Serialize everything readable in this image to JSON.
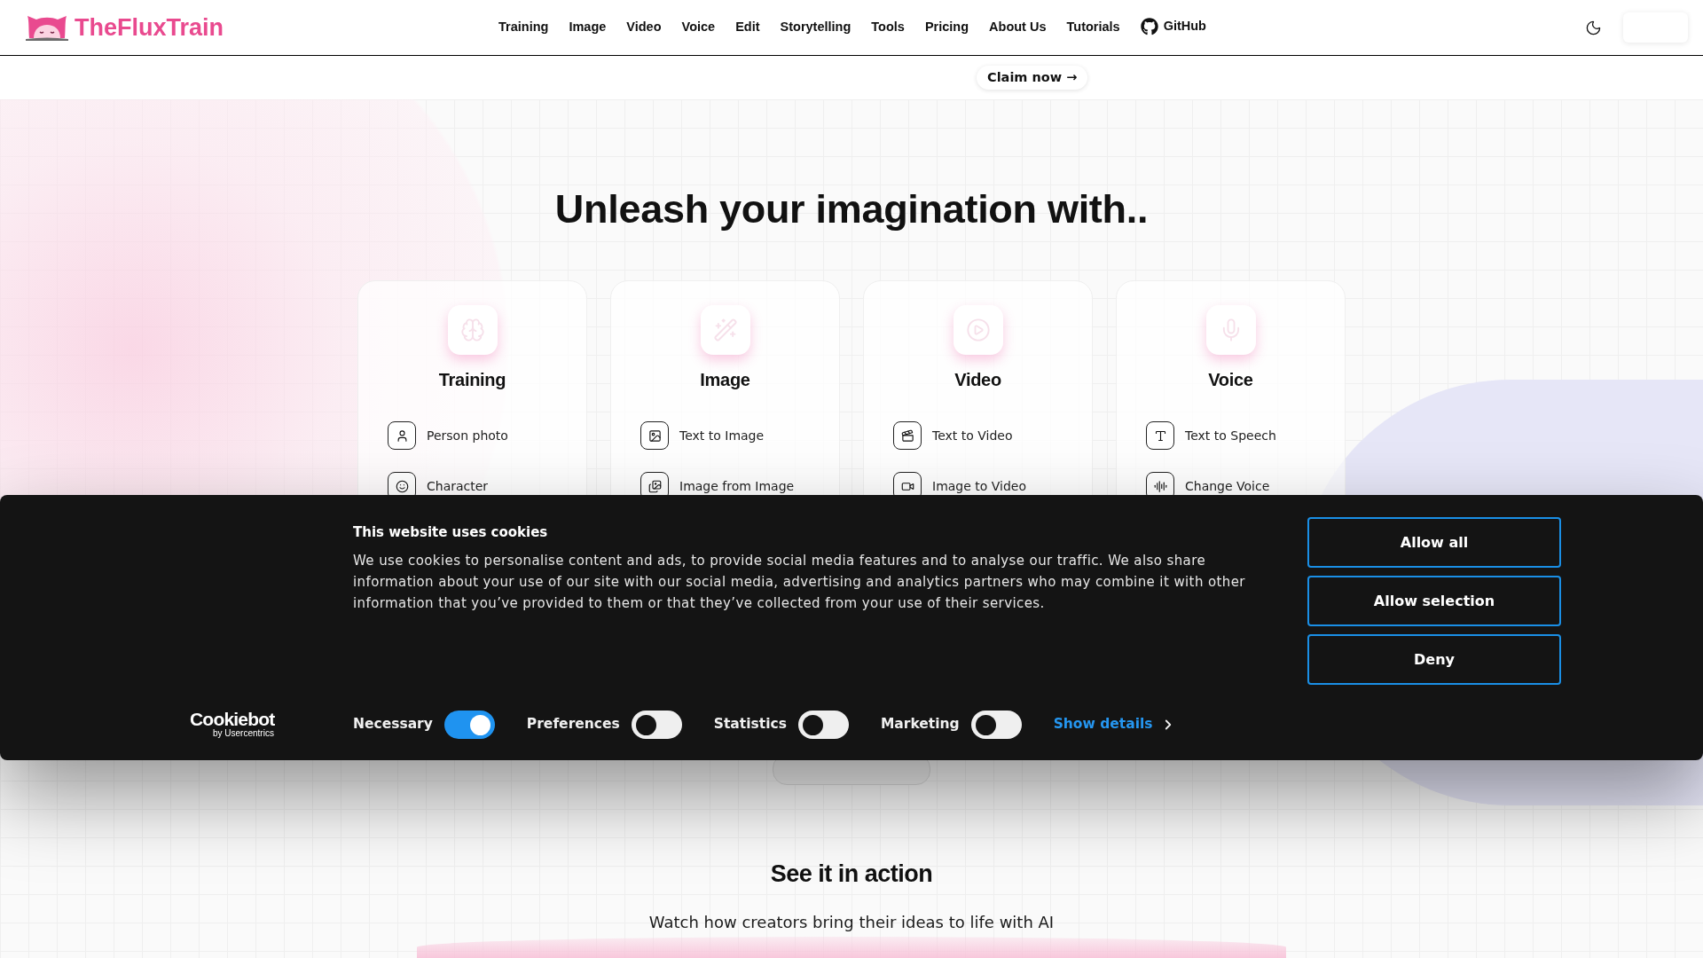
{
  "header": {
    "logo_text": "TheFluxTrain",
    "nav": [
      {
        "label": "Training",
        "kind": "link"
      },
      {
        "label": "Image",
        "kind": "link"
      },
      {
        "label": "Video",
        "kind": "link"
      },
      {
        "label": "Voice",
        "kind": "link"
      },
      {
        "label": "Edit",
        "kind": "link"
      },
      {
        "label": "Storytelling",
        "kind": "link"
      },
      {
        "label": "Tools",
        "kind": "link"
      },
      {
        "label": "Pricing",
        "kind": "link"
      },
      {
        "label": "About Us",
        "kind": "link"
      },
      {
        "label": "Tutorials",
        "kind": "link"
      },
      {
        "label": "GitHub",
        "kind": "github"
      }
    ]
  },
  "promo_bar": {
    "button": "Claim now →"
  },
  "hero": {
    "title": "Unleash your imagination with..",
    "cards": [
      {
        "title": "Training",
        "items": [
          "Person photo",
          "Character"
        ]
      },
      {
        "title": "Image",
        "items": [
          "Text to Image",
          "Image from Image"
        ]
      },
      {
        "title": "Video",
        "items": [
          "Text to Video",
          "Image to Video"
        ]
      },
      {
        "title": "Voice",
        "items": [
          "Text to Speech",
          "Change Voice"
        ]
      }
    ]
  },
  "showcase": {
    "title": "See it in action",
    "subtitle": "Watch how creators bring their ideas to life with AI"
  },
  "cookie_banner": {
    "title": "This website uses cookies",
    "text": "We use cookies to personalise content and ads, to provide social media features and to analyse our traffic. We also share information about your use of our site with our social media, advertising and analytics partners who may combine it with other information that you’ve provided to them or that they’ve collected from your use of their services.",
    "buttons": [
      "Allow all",
      "Allow selection",
      "Deny"
    ],
    "logo": {
      "wordmark": "Cookiebot",
      "tagline": "by Usercentrics"
    },
    "consents": [
      {
        "label": "Necessary",
        "on": true
      },
      {
        "label": "Preferences",
        "on": false
      },
      {
        "label": "Statistics",
        "on": false
      },
      {
        "label": "Marketing",
        "on": false
      }
    ],
    "details_link": "Show details"
  }
}
